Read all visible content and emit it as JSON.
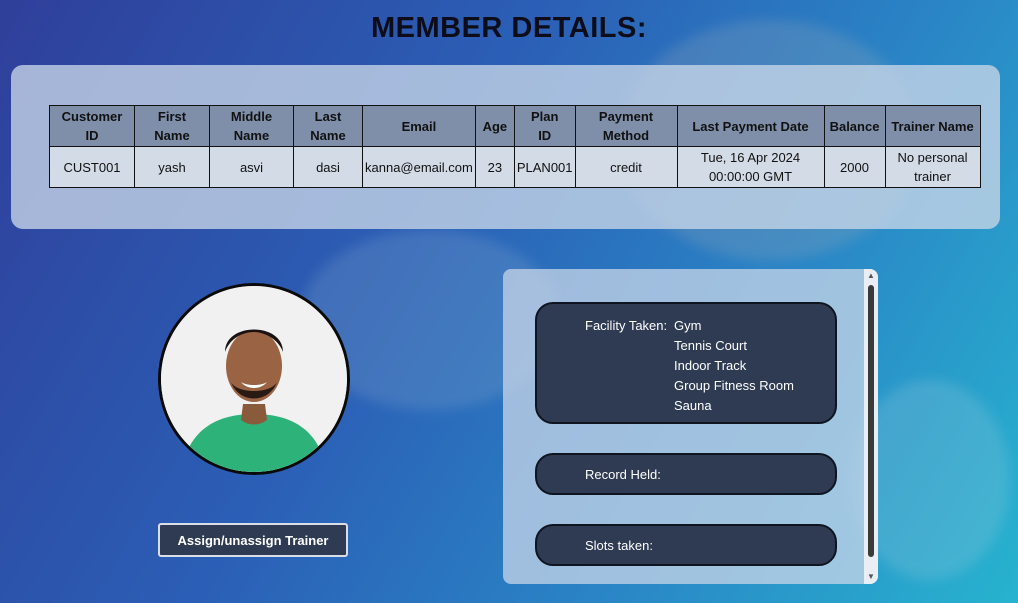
{
  "page": {
    "title": "MEMBER DETAILS:"
  },
  "member_table": {
    "headers": [
      [
        "Customer",
        "ID"
      ],
      [
        "First",
        "Name"
      ],
      [
        "Middle",
        "Name"
      ],
      [
        "Last",
        "Name"
      ],
      [
        "Email"
      ],
      [
        "Age"
      ],
      [
        "Plan",
        "ID"
      ],
      [
        "Payment",
        "Method"
      ],
      [
        "Last Payment Date"
      ],
      [
        "Balance"
      ],
      [
        "Trainer Name"
      ]
    ],
    "row": [
      [
        "CUST001"
      ],
      [
        "yash"
      ],
      [
        "asvi"
      ],
      [
        "dasi"
      ],
      [
        "kanna@email.com"
      ],
      [
        "23"
      ],
      [
        "PLAN001"
      ],
      [
        "credit"
      ],
      [
        "Tue, 16 Apr 2024",
        "00:00:00 GMT"
      ],
      [
        "2000"
      ],
      [
        "No personal",
        "trainer"
      ]
    ]
  },
  "actions": {
    "assign_label": "Assign/unassign Trainer"
  },
  "info": {
    "facility_label": "Facility Taken:",
    "facilities": [
      "Gym",
      "Tennis Court",
      "Indoor Track",
      "Group Fitness Room",
      "Sauna"
    ],
    "record_label": "Record Held:",
    "slots_label": "Slots taken:"
  },
  "icons": {
    "scroll_up": "triangle-up-icon",
    "scroll_down": "triangle-down-icon"
  },
  "colors": {
    "box_bg": "#2e3b52",
    "header_bg": "#7f8faa",
    "panel_bg": "#c8d6e8"
  }
}
